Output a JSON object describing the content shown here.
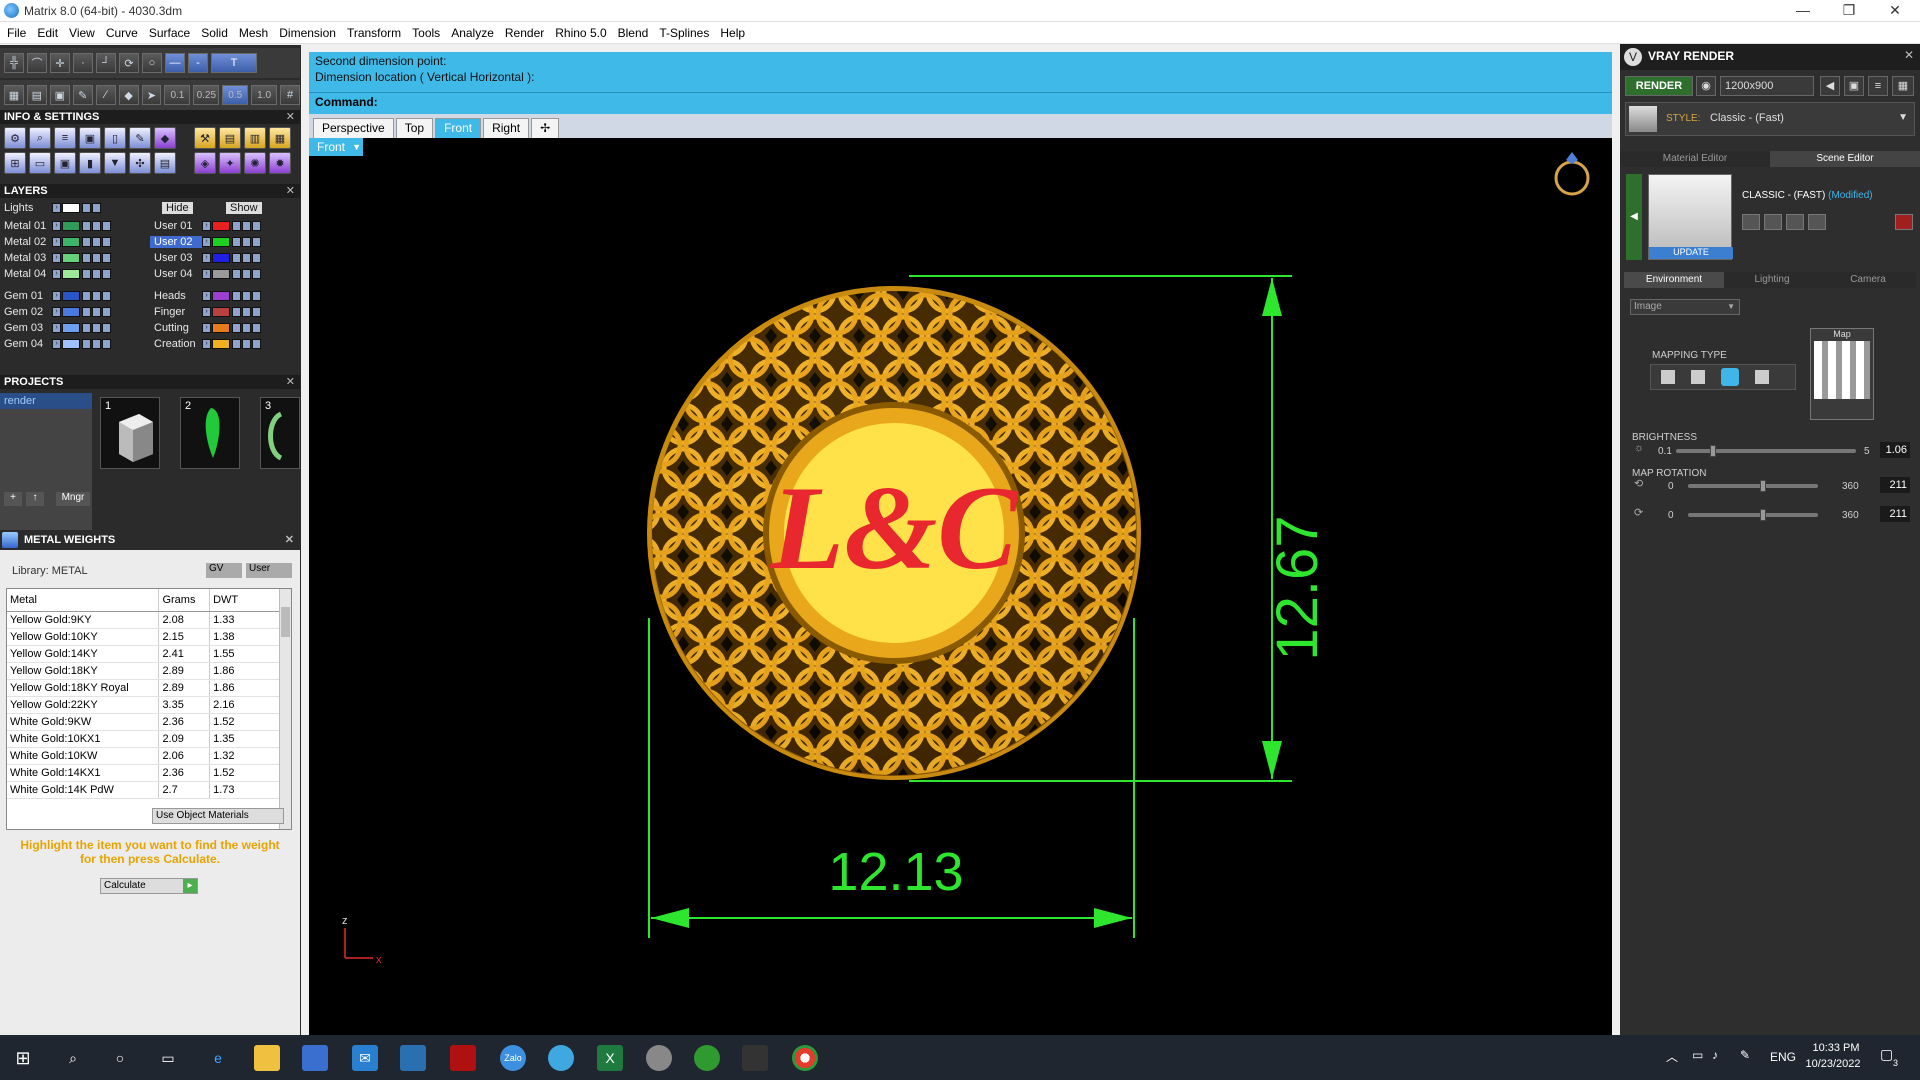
{
  "window": {
    "title": "Matrix 8.0 (64-bit) - 4030.3dm",
    "min": "—",
    "max": "❐",
    "close": "✕"
  },
  "menu": [
    "File",
    "Edit",
    "View",
    "Curve",
    "Surface",
    "Solid",
    "Mesh",
    "Dimension",
    "Transform",
    "Tools",
    "Analyze",
    "Render",
    "Rhino 5.0",
    "Blend",
    "T-Splines",
    "Help"
  ],
  "toolbar": {
    "snap_values": [
      "0.1",
      "0.25",
      "0.5",
      "1.0"
    ]
  },
  "info_settings": {
    "title": "INFO & SETTINGS"
  },
  "layers": {
    "title": "LAYERS",
    "lights_label": "Lights",
    "hide_label": "Hide",
    "show_label": "Show",
    "left": [
      {
        "name": "Metal 01",
        "color": "#2f9a5a"
      },
      {
        "name": "Metal 02",
        "color": "#3cb56a"
      },
      {
        "name": "Metal 03",
        "color": "#66d07a"
      },
      {
        "name": "Metal 04",
        "color": "#9ee89a"
      },
      {
        "name": "Gem 01",
        "color": "#2a55c8"
      },
      {
        "name": "Gem 02",
        "color": "#4a7ae0"
      },
      {
        "name": "Gem 03",
        "color": "#6f9ff0"
      },
      {
        "name": "Gem 04",
        "color": "#9fc2ff"
      }
    ],
    "right": [
      {
        "name": "User 01",
        "color": "#e82020"
      },
      {
        "name": "User 02",
        "color": "#20d020",
        "selected": true
      },
      {
        "name": "User 03",
        "color": "#2020e0"
      },
      {
        "name": "User 04",
        "color": "#9a9a9a"
      },
      {
        "name": "Heads",
        "color": "#9a3fd0"
      },
      {
        "name": "Finger",
        "color": "#b84040"
      },
      {
        "name": "Cutting",
        "color": "#e87a20"
      },
      {
        "name": "Creation",
        "color": "#f0b020"
      }
    ]
  },
  "projects": {
    "title": "PROJECTS",
    "list_item": "render",
    "thumbs": [
      "1",
      "2",
      "3"
    ],
    "mngr": "Mngr"
  },
  "metal_weights": {
    "title": "METAL WEIGHTS",
    "library": "Library: METAL",
    "gv": "GV",
    "user": "User",
    "columns": [
      "Metal",
      "Grams",
      "DWT"
    ],
    "rows": [
      [
        "Yellow Gold:9KY",
        "2.08",
        "1.33"
      ],
      [
        "Yellow Gold:10KY",
        "2.15",
        "1.38"
      ],
      [
        "Yellow Gold:14KY",
        "2.41",
        "1.55"
      ],
      [
        "Yellow Gold:18KY",
        "2.89",
        "1.86"
      ],
      [
        "Yellow Gold:18KY Royal",
        "2.89",
        "1.86"
      ],
      [
        "Yellow Gold:22KY",
        "3.35",
        "2.16"
      ],
      [
        "White Gold:9KW",
        "2.36",
        "1.52"
      ],
      [
        "White Gold:10KX1",
        "2.09",
        "1.35"
      ],
      [
        "White Gold:10KW",
        "2.06",
        "1.32"
      ],
      [
        "White Gold:14KX1",
        "2.36",
        "1.52"
      ],
      [
        "White Gold:14K PdW",
        "2.7",
        "1.73"
      ]
    ],
    "use_object_materials": "Use Object Materials",
    "hint": "Highlight the item you want to find the weight for then press Calculate.",
    "calculate": "Calculate"
  },
  "command": {
    "line1": "Second dimension point:",
    "line2": "Dimension location ( Vertical  Horizontal ):",
    "prompt": "Command:"
  },
  "viewport_tabs": [
    "Perspective",
    "Top",
    "Front",
    "Right"
  ],
  "active_tab": "Front",
  "viewport_label": "Front",
  "dimensions": {
    "vertical": "12.67",
    "horizontal": "12.13"
  },
  "pendant_monogram": "L&C",
  "axes": {
    "z": "z",
    "x": "x"
  },
  "vray": {
    "title": "VRAY RENDER",
    "render": "RENDER",
    "resolution": "1200x900",
    "style_label": "STYLE:",
    "style_value": "Classic - (Fast)",
    "tab_material": "Material Editor",
    "tab_scene": "Scene Editor",
    "preset_name": "CLASSIC - (FAST)",
    "preset_modified": "(Modified)",
    "update": "UPDATE",
    "env_tabs": [
      "Environment",
      "Lighting",
      "Camera"
    ],
    "image_select": "Image",
    "map_label": "Map",
    "mapping_type": "MAPPING TYPE",
    "brightness_label": "BRIGHTNESS",
    "brightness_min": "0.1",
    "brightness_max": "5",
    "brightness_value": "1.06",
    "map_rotation_label": "MAP ROTATION",
    "rot_min": "0",
    "rot_max": "360",
    "rot1_value": "211",
    "rot2_value": "211"
  },
  "taskbar": {
    "lang": "ENG",
    "time": "10:33 PM",
    "date": "10/23/2022",
    "notif": "3"
  }
}
